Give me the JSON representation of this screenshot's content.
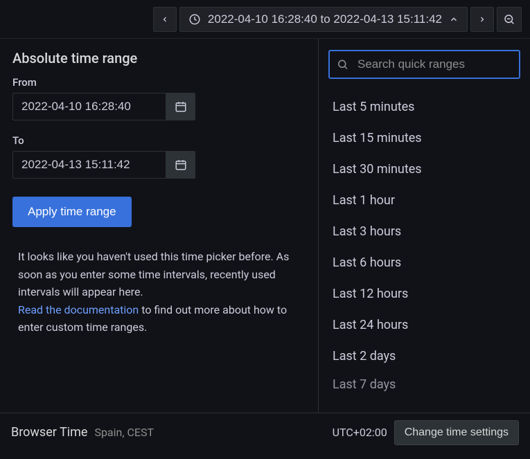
{
  "toolbar": {
    "time_display": "2022-04-10 16:28:40 to 2022-04-13 15:11:42"
  },
  "absolute": {
    "title": "Absolute time range",
    "from_label": "From",
    "from_value": "2022-04-10 16:28:40",
    "to_label": "To",
    "to_value": "2022-04-13 15:11:42",
    "apply_label": "Apply time range"
  },
  "help": {
    "text1": "It looks like you haven't used this time picker before. As soon as you enter some time intervals, recently used intervals will appear here.",
    "link": "Read the documentation",
    "text2": " to find out more about how to enter custom time ranges."
  },
  "search": {
    "placeholder": "Search quick ranges"
  },
  "quick_ranges": [
    "Last 5 minutes",
    "Last 15 minutes",
    "Last 30 minutes",
    "Last 1 hour",
    "Last 3 hours",
    "Last 6 hours",
    "Last 12 hours",
    "Last 24 hours",
    "Last 2 days",
    "Last 7 days"
  ],
  "footer": {
    "tz_title": "Browser Time",
    "tz_sub": "Spain, CEST",
    "tz_offset": "UTC+02:00",
    "change_label": "Change time settings"
  }
}
